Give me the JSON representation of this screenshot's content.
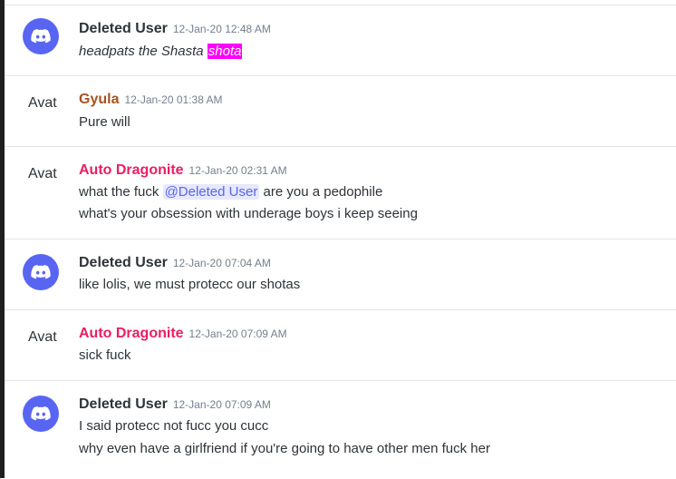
{
  "messages": [
    {
      "author": "Deleted User",
      "timestamp": "12-Jan-20 12:48 AM",
      "avatar": "discord-logo-icon",
      "line1_pre": "headpats the Shasta ",
      "line1_highlight": "shota"
    },
    {
      "author": "Gyula",
      "timestamp": "12-Jan-20 01:38 AM",
      "avatar_text": "Avat",
      "line1": "Pure will"
    },
    {
      "author": "Auto Dragonite",
      "timestamp": "12-Jan-20 02:31 AM",
      "avatar_text": "Avat",
      "line1_pre": "what the fuck ",
      "mention": "@Deleted User",
      "line1_post": " are you a pedophile",
      "line2": "what's your obsession with underage boys i keep seeing"
    },
    {
      "author": "Deleted User",
      "timestamp": "12-Jan-20 07:04 AM",
      "avatar": "discord-logo-icon",
      "line1": "like lolis, we must protecc our shotas"
    },
    {
      "author": "Auto Dragonite",
      "timestamp": "12-Jan-20 07:09 AM",
      "avatar_text": "Avat",
      "line1": "sick fuck"
    },
    {
      "author": "Deleted User",
      "timestamp": "12-Jan-20 07:09 AM",
      "avatar": "discord-logo-icon",
      "line1": "I said protecc not fucc you cucc",
      "line2": "why even have a girlfriend if you're going to have other men fuck her"
    }
  ],
  "colors": {
    "discord_blurple": "#5865f2",
    "gyula_name": "#a6541f",
    "dragonite_name": "#e91e63",
    "highlight": "#ff00ff"
  }
}
